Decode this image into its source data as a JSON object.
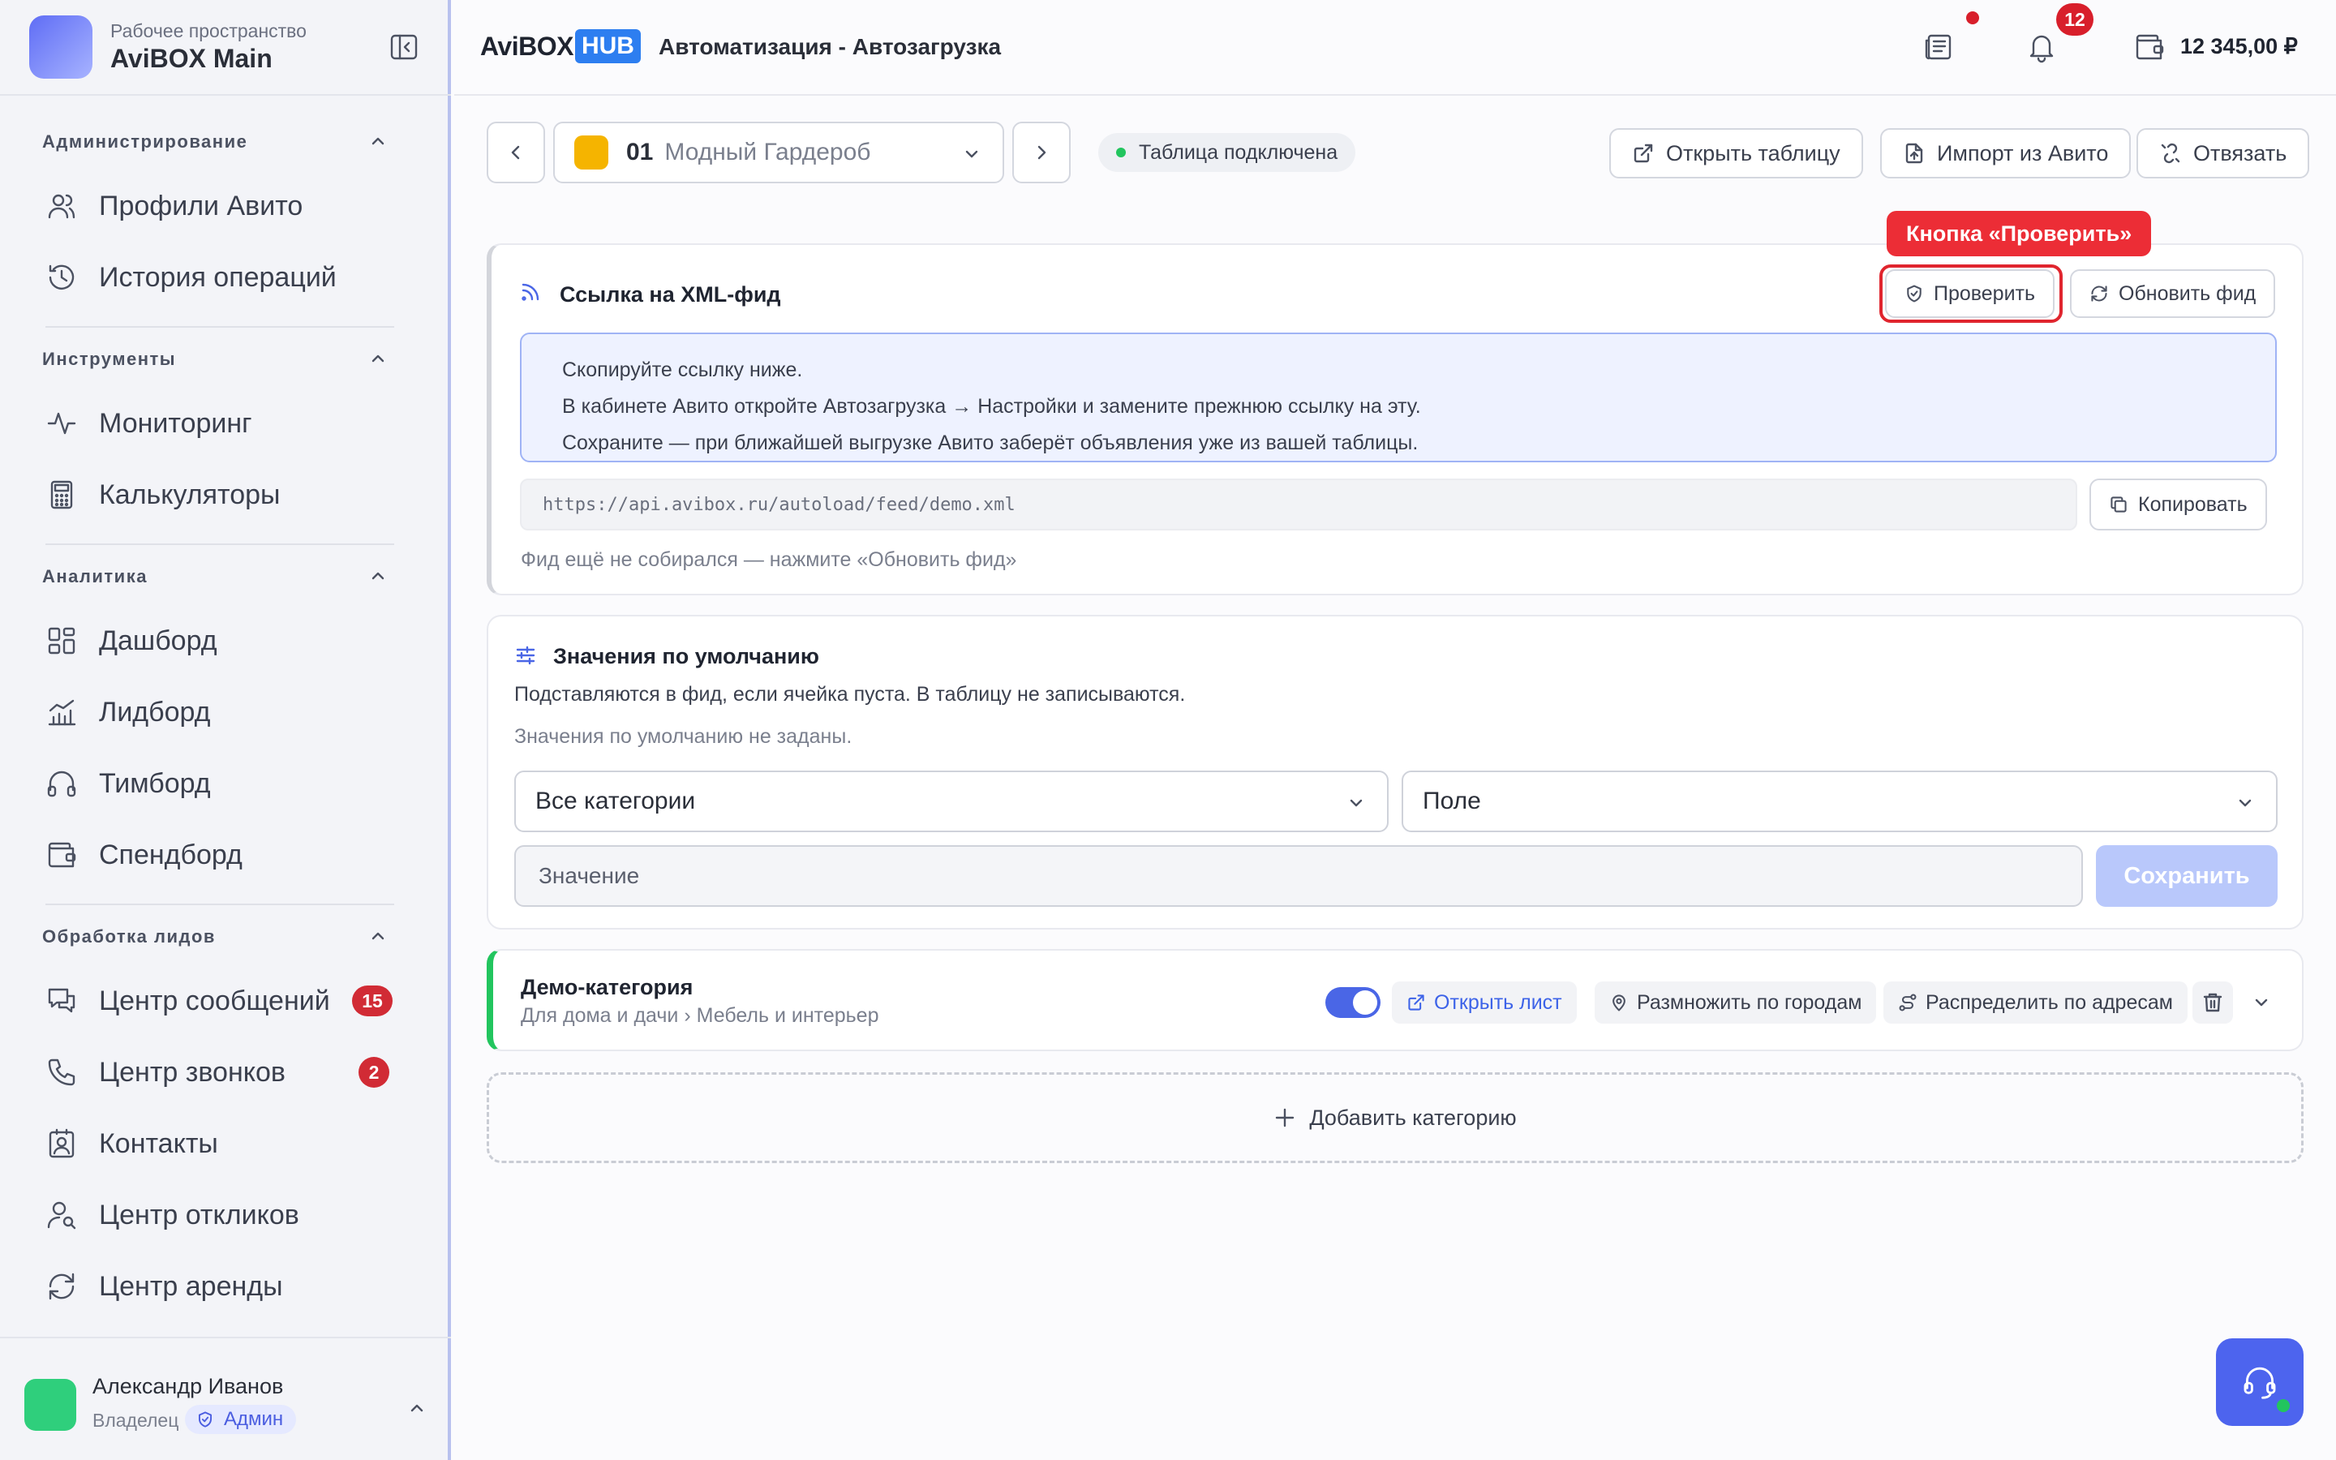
{
  "workspace": {
    "subtitle": "Рабочее пространство",
    "name": "AviBOX Main"
  },
  "sidebar": {
    "sections": [
      {
        "title": "Администрирование",
        "items": [
          {
            "label": "Профили Авито",
            "icon": "users-icon"
          },
          {
            "label": "История операций",
            "icon": "history-icon"
          }
        ]
      },
      {
        "title": "Инструменты",
        "items": [
          {
            "label": "Мониторинг",
            "icon": "activity-icon"
          },
          {
            "label": "Калькуляторы",
            "icon": "calculator-icon"
          }
        ]
      },
      {
        "title": "Аналитика",
        "items": [
          {
            "label": "Дашборд",
            "icon": "dashboard-icon"
          },
          {
            "label": "Лидборд",
            "icon": "chart-icon"
          },
          {
            "label": "Тимборд",
            "icon": "headphones-icon"
          },
          {
            "label": "Спендборд",
            "icon": "wallet-icon"
          }
        ]
      },
      {
        "title": "Обработка лидов",
        "items": [
          {
            "label": "Центр сообщений",
            "icon": "messages-icon",
            "badge": "15"
          },
          {
            "label": "Центр звонков",
            "icon": "phone-icon",
            "badge": "2"
          },
          {
            "label": "Контакты",
            "icon": "contacts-icon"
          },
          {
            "label": "Центр откликов",
            "icon": "user-search-icon"
          },
          {
            "label": "Центр аренды",
            "icon": "refresh-icon"
          }
        ]
      }
    ]
  },
  "user": {
    "name": "Александр Иванов",
    "role": "Владелец",
    "badge": "Админ"
  },
  "header": {
    "brand_main": "AviBOX",
    "brand_hub": "HUB",
    "title": "Автоматизация - Автозагрузка",
    "notifications": "12",
    "balance": "12 345,00 ₽"
  },
  "toolbar": {
    "profile_number": "01",
    "profile_name": "Модный Гардероб",
    "status": "Таблица подключена",
    "open_table": "Открыть таблицу",
    "import": "Импорт из Авито",
    "unlink": "Отвязать"
  },
  "xml_feed": {
    "title": "Ссылка на XML-фид",
    "check_label": "Проверить",
    "update_label": "Обновить фид",
    "callout": "Кнопка «Проверить»",
    "instructions": [
      "Скопируйте ссылку ниже.",
      "В кабинете Авито откройте Автозагрузка → Настройки и замените прежнюю ссылку на эту.",
      "Сохраните — при ближайшей выгрузке Авито заберёт объявления уже из вашей таблицы."
    ],
    "url": "https://api.avibox.ru/autoload/feed/demo.xml",
    "copy_label": "Копировать",
    "status": "Фид ещё не собирался — нажмите «Обновить фид»"
  },
  "defaults": {
    "title": "Значения по умолчанию",
    "description": "Подставляются в фид, если ячейка пуста. В таблицу не записываются.",
    "empty": "Значения по умолчанию не заданы.",
    "category_select": "Все категории",
    "field_select": "Поле",
    "value_placeholder": "Значение",
    "save_label": "Сохранить"
  },
  "category": {
    "title": "Демо-категория",
    "path": "Для дома и дачи › Мебель и интерьер",
    "enabled": true,
    "open_sheet": "Открыть лист",
    "multiply": "Размножить по городам",
    "distribute": "Распределить по адресам"
  },
  "add_category": "Добавить категорию",
  "colors": {
    "accent": "#4a66e6",
    "danger": "#e0252e",
    "success": "#22c55e",
    "brand_hub": "#2d7ef0"
  }
}
